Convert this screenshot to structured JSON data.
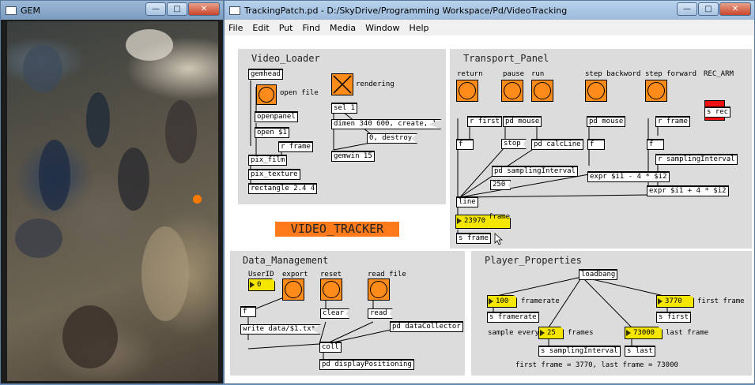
{
  "gem": {
    "title": "GEM"
  },
  "pd": {
    "title": "TrackingPatch.pd  - D:/SkyDrive/Programming Workspace/Pd/VideoTracking",
    "menu": [
      "File",
      "Edit",
      "Put",
      "Find",
      "Media",
      "Window",
      "Help"
    ]
  },
  "window_buttons": {
    "minimize": "—",
    "maximize": "□",
    "close": "✕"
  },
  "video_loader": {
    "title": "Video_Loader",
    "gemhead": "gemhead",
    "open_file": "open file",
    "openpanel": "openpanel",
    "open": "open $1",
    "r_frame": "r frame",
    "pix_film": "pix_film",
    "pix_texture": "pix_texture",
    "rectangle": "rectangle 2.4 4",
    "rendering": "rendering",
    "sel": "sel 1",
    "dimen": "dimen 340 600, create, 1",
    "destroy": "0, destroy",
    "gemwin": "gemwin 15"
  },
  "tracker_label": "VIDEO_TRACKER",
  "transport": {
    "title": "Transport_Panel",
    "return": "return",
    "pause": "pause",
    "run": "run",
    "step_backword": "step backword",
    "step_forward": "step forward",
    "rec_arm": "REC_ARM",
    "r_first": "r first",
    "pd_mouse1": "pd mouse",
    "pd_mouse2": "pd mouse",
    "s_rec": "s rec",
    "r_frame": "r frame",
    "f1": "f",
    "stop": "stop",
    "calcline": "pd calcLine",
    "f2": "f",
    "f3": "f",
    "r_sampling": "r samplingInterval",
    "pd_sampling": "pd samplingInterval",
    "expr1": "expr $i1 - 4 * $i2",
    "v250": "250",
    "expr2": "expr $i1 + 4 * $i2",
    "line": "line",
    "frame_value": "23970",
    "frame_label": "frame",
    "s_frame": "s frame"
  },
  "data_mgmt": {
    "title": "Data_Management",
    "userid": "UserID",
    "userid_value": "0",
    "export": "export",
    "reset": "reset",
    "read_file": "read file",
    "f": "f",
    "clear": "clear",
    "read": "read",
    "write": "write data/$1.txt",
    "collector": "pd dataCollector",
    "coll": "coll",
    "display": "pd displayPositioning"
  },
  "player": {
    "title": "Player_Properties",
    "loadbang": "loadbang",
    "framerate_value": "100",
    "framerate_label": "framerate",
    "s_framerate": "s framerate",
    "first_value": "3770",
    "first_label": "first frame",
    "s_first": "s first",
    "sample_every": "sample every",
    "frames_value": "25",
    "frames_label": "frames",
    "s_sampling": "s samplingInterval",
    "last_value": "73000",
    "last_label": "last frame",
    "s_last": "s last",
    "summary": "first frame = 3770, last frame = 73000"
  }
}
